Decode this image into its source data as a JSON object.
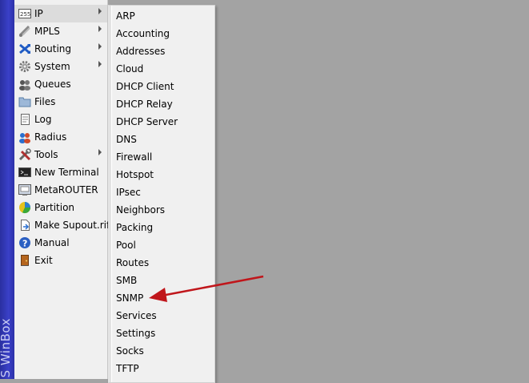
{
  "brand": {
    "text": "S WinBox"
  },
  "main_menu": {
    "items": [
      {
        "label": "IP",
        "icon": "ip-icon",
        "submenu": true
      },
      {
        "label": "MPLS",
        "icon": "mpls-icon",
        "submenu": true
      },
      {
        "label": "Routing",
        "icon": "routing-icon",
        "submenu": true
      },
      {
        "label": "System",
        "icon": "gear-icon",
        "submenu": true
      },
      {
        "label": "Queues",
        "icon": "queues-icon",
        "submenu": false
      },
      {
        "label": "Files",
        "icon": "folder-icon",
        "submenu": false
      },
      {
        "label": "Log",
        "icon": "log-icon",
        "submenu": false
      },
      {
        "label": "Radius",
        "icon": "radius-icon",
        "submenu": false
      },
      {
        "label": "Tools",
        "icon": "tools-icon",
        "submenu": true
      },
      {
        "label": "New Terminal",
        "icon": "terminal-icon",
        "submenu": false
      },
      {
        "label": "MetaROUTER",
        "icon": "metarouter-icon",
        "submenu": false
      },
      {
        "label": "Partition",
        "icon": "partition-icon",
        "submenu": false
      },
      {
        "label": "Make Supout.rif",
        "icon": "supout-icon",
        "submenu": false
      },
      {
        "label": "Manual",
        "icon": "help-icon",
        "submenu": false
      },
      {
        "label": "Exit",
        "icon": "exit-icon",
        "submenu": false
      }
    ]
  },
  "ip_submenu": {
    "items": [
      "ARP",
      "Accounting",
      "Addresses",
      "Cloud",
      "DHCP Client",
      "DHCP Relay",
      "DHCP Server",
      "DNS",
      "Firewall",
      "Hotspot",
      "IPsec",
      "Neighbors",
      "Packing",
      "Pool",
      "Routes",
      "SMB",
      "SNMP",
      "Services",
      "Settings",
      "Socks",
      "TFTP"
    ]
  },
  "colors": {
    "annotation_arrow": "#c0161b",
    "desktop": "#a3a3a3",
    "menu_bg": "#f0f0f0"
  }
}
